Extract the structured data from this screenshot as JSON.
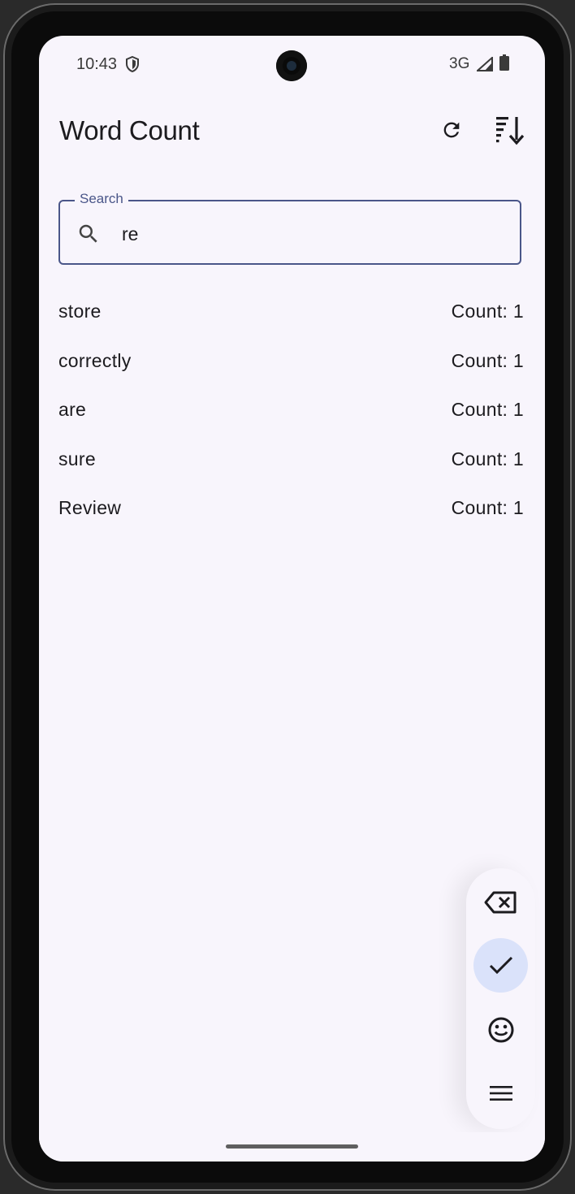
{
  "status_bar": {
    "time": "10:43",
    "network": "3G",
    "icons": [
      "shield-icon",
      "signal-icon",
      "battery-icon"
    ]
  },
  "app_bar": {
    "title": "Word Count",
    "actions": [
      "refresh-icon",
      "sort-icon"
    ]
  },
  "search": {
    "label": "Search",
    "value": "re",
    "icon": "search-icon"
  },
  "words": [
    {
      "word": "store",
      "count": "Count: 1"
    },
    {
      "word": "correctly",
      "count": "Count: 1"
    },
    {
      "word": "are",
      "count": "Count: 1"
    },
    {
      "word": "sure",
      "count": "Count: 1"
    },
    {
      "word": "Review",
      "count": "Count: 1"
    }
  ],
  "keyboard_toolbar": {
    "buttons": [
      "backspace-icon",
      "check-icon",
      "emoji-icon",
      "menu-icon"
    ],
    "active": "check-icon"
  },
  "colors": {
    "background": "#f8f5fc",
    "accent": "#4a5689",
    "active_button": "#dae2fa",
    "text": "#1c1b1f"
  }
}
